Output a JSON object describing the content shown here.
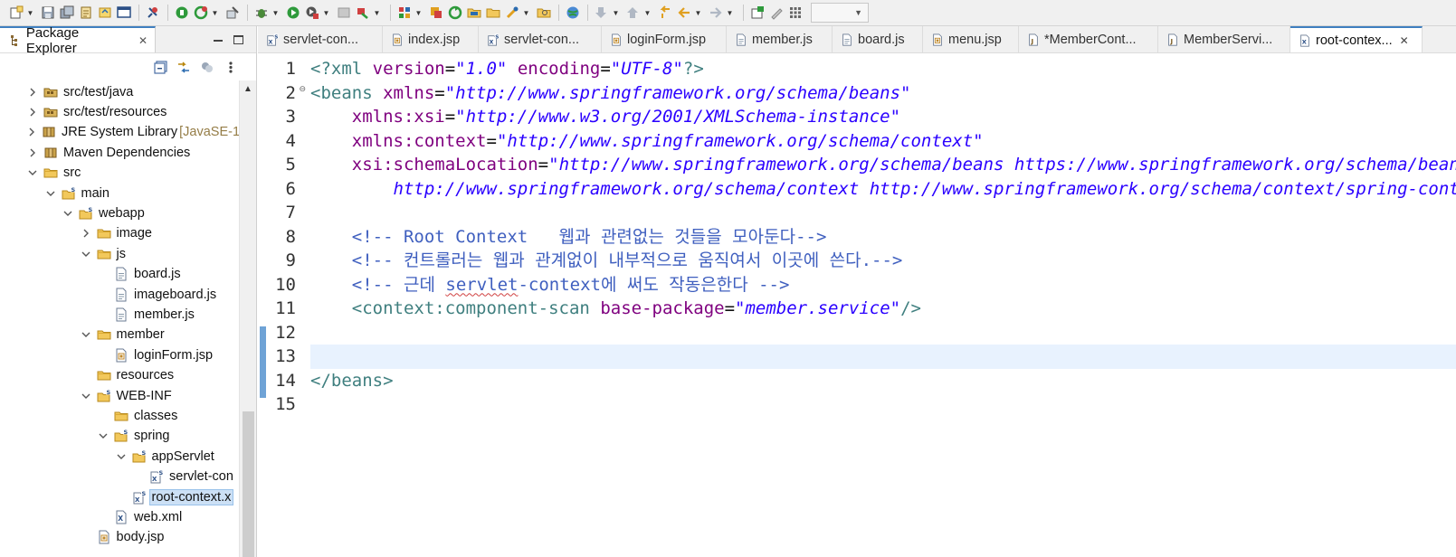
{
  "toolbar": {
    "icons": [
      "new-icon",
      "save-icon",
      "save-all-icon",
      "publish-icon",
      "refactor-icon",
      "console-icon",
      "pin-icon",
      "stop-icon",
      "refresh-icon",
      "deploy-icon",
      "debug-icon",
      "run-icon",
      "run-config-icon",
      "coverage-icon",
      "external-tools-icon",
      "team-icon",
      "compare-icon",
      "synchronize-icon",
      "open-folder-icon",
      "open-type-icon",
      "open-task-icon",
      "search-icon",
      "globe-icon",
      "next-annotation-icon",
      "prev-annotation-icon",
      "last-edit-icon",
      "back-icon",
      "forward-icon",
      "new-window-icon",
      "pen-icon",
      "perspective-icon"
    ],
    "combo_value": ""
  },
  "left_pane": {
    "tab_label": "Package Explorer",
    "tab_close": "✕",
    "view_toolbar_icons": [
      "collapse-all-icon",
      "link-editor-icon",
      "filters-icon",
      "view-menu-icon"
    ],
    "tree": [
      {
        "label": "src/test/java",
        "deco": "",
        "icon": "source-folder-icon",
        "level": 1,
        "state": "collapsed"
      },
      {
        "label": "src/test/resources",
        "deco": "",
        "icon": "source-folder-icon",
        "level": 1,
        "state": "collapsed"
      },
      {
        "label": "JRE System Library",
        "deco": " [JavaSE-1",
        "icon": "library-icon",
        "level": 1,
        "state": "collapsed"
      },
      {
        "label": "Maven Dependencies",
        "deco": "",
        "icon": "library-icon",
        "level": 1,
        "state": "collapsed"
      },
      {
        "label": "src",
        "deco": "",
        "icon": "folder-icon",
        "level": 1,
        "state": "expanded"
      },
      {
        "label": "main",
        "deco": "",
        "icon": "web-folder-icon",
        "level": 2,
        "state": "expanded"
      },
      {
        "label": "webapp",
        "deco": "",
        "icon": "web-folder-icon",
        "level": 3,
        "state": "expanded"
      },
      {
        "label": "image",
        "deco": "",
        "icon": "folder-icon",
        "level": 4,
        "state": "collapsed"
      },
      {
        "label": "js",
        "deco": "",
        "icon": "folder-icon",
        "level": 4,
        "state": "expanded"
      },
      {
        "label": "board.js",
        "deco": "",
        "icon": "js-file-icon",
        "level": 5,
        "state": "leaf"
      },
      {
        "label": "imageboard.js",
        "deco": "",
        "icon": "js-file-icon",
        "level": 5,
        "state": "leaf"
      },
      {
        "label": "member.js",
        "deco": "",
        "icon": "js-file-icon",
        "level": 5,
        "state": "leaf"
      },
      {
        "label": "member",
        "deco": "",
        "icon": "folder-icon",
        "level": 4,
        "state": "expanded"
      },
      {
        "label": "loginForm.jsp",
        "deco": "",
        "icon": "jsp-file-icon",
        "level": 5,
        "state": "leaf"
      },
      {
        "label": "resources",
        "deco": "",
        "icon": "folder-icon",
        "level": 4,
        "state": "leaf"
      },
      {
        "label": "WEB-INF",
        "deco": "",
        "icon": "web-folder-icon",
        "level": 4,
        "state": "expanded"
      },
      {
        "label": "classes",
        "deco": "",
        "icon": "folder-icon",
        "level": 5,
        "state": "leaf"
      },
      {
        "label": "spring",
        "deco": "",
        "icon": "web-folder-icon",
        "level": 5,
        "state": "expanded"
      },
      {
        "label": "appServlet",
        "deco": "",
        "icon": "web-folder-icon",
        "level": 6,
        "state": "expanded"
      },
      {
        "label": "servlet-con",
        "deco": "",
        "icon": "spring-xml-icon",
        "level": 7,
        "state": "leaf"
      },
      {
        "label": "root-context.x",
        "deco": "",
        "icon": "spring-xml-icon",
        "level": 6,
        "state": "leaf",
        "selected": true
      },
      {
        "label": "web.xml",
        "deco": "",
        "icon": "xml-file-icon",
        "level": 5,
        "state": "leaf"
      },
      {
        "label": "body.jsp",
        "deco": "",
        "icon": "jsp-file-icon",
        "level": 4,
        "state": "leaf"
      }
    ]
  },
  "editor": {
    "tabs": [
      {
        "label": "servlet-con...",
        "icon": "spring-xml-icon",
        "active": false
      },
      {
        "label": "index.jsp",
        "icon": "jsp-file-icon",
        "active": false
      },
      {
        "label": "servlet-con...",
        "icon": "spring-xml-icon",
        "active": false
      },
      {
        "label": "loginForm.jsp",
        "icon": "jsp-file-icon",
        "active": false
      },
      {
        "label": "member.js",
        "icon": "js-file-icon",
        "active": false
      },
      {
        "label": "board.js",
        "icon": "js-file-icon",
        "active": false
      },
      {
        "label": "menu.jsp",
        "icon": "jsp-file-icon",
        "active": false
      },
      {
        "label": "*MemberCont...",
        "icon": "java-file-icon",
        "active": false
      },
      {
        "label": "MemberServi...",
        "icon": "java-file-icon",
        "active": false
      },
      {
        "label": "root-contex...",
        "icon": "xml-file-icon",
        "active": true,
        "close": "✕"
      }
    ],
    "current_line": 13,
    "lines": [
      {
        "n": "1",
        "fold": "",
        "tokens": [
          [
            "tag",
            "<?xml "
          ],
          [
            "attr",
            "version"
          ],
          [
            "plain",
            "="
          ],
          [
            "val",
            "\"1.0\""
          ],
          [
            "plain",
            " "
          ],
          [
            "attr",
            "encoding"
          ],
          [
            "plain",
            "="
          ],
          [
            "val",
            "\"UTF-8\""
          ],
          [
            "tag",
            "?>"
          ]
        ]
      },
      {
        "n": "2",
        "fold": "⊖",
        "tokens": [
          [
            "tag",
            "<beans "
          ],
          [
            "attr",
            "xmlns"
          ],
          [
            "plain",
            "="
          ],
          [
            "val",
            "\"http://www.springframework.org/schema/beans\""
          ]
        ]
      },
      {
        "n": "3",
        "fold": "",
        "tokens": [
          [
            "plain",
            "    "
          ],
          [
            "attr",
            "xmlns:xsi"
          ],
          [
            "plain",
            "="
          ],
          [
            "val",
            "\"http://www.w3.org/2001/XMLSchema-instance\""
          ]
        ]
      },
      {
        "n": "4",
        "fold": "",
        "tokens": [
          [
            "plain",
            "    "
          ],
          [
            "attr",
            "xmlns:context"
          ],
          [
            "plain",
            "="
          ],
          [
            "val",
            "\"http://www.springframework.org/schema/context\""
          ]
        ]
      },
      {
        "n": "5",
        "fold": "",
        "tokens": [
          [
            "plain",
            "    "
          ],
          [
            "attr",
            "xsi:schemaLocation"
          ],
          [
            "plain",
            "="
          ],
          [
            "val",
            "\"http://www.springframework.org/schema/beans https://www.springframework.org/schema/beans/spring-beans.xsd"
          ]
        ]
      },
      {
        "n": "6",
        "fold": "",
        "tokens": [
          [
            "val",
            "        http://www.springframework.org/schema/context http://www.springframework.org/schema/context/spring-context.xsd\""
          ],
          [
            "tag",
            ">"
          ]
        ]
      },
      {
        "n": "7",
        "fold": "",
        "tokens": []
      },
      {
        "n": "8",
        "fold": "",
        "tokens": [
          [
            "plain",
            "    "
          ],
          [
            "cmt",
            "<!-- Root Context   웹과 관련없는 것들을 모아둔다-->"
          ]
        ]
      },
      {
        "n": "9",
        "fold": "",
        "tokens": [
          [
            "plain",
            "    "
          ],
          [
            "cmt",
            "<!-- 컨트롤러는 웹과 관계없이 내부적으로 움직여서 이곳에 쓴다.-->"
          ]
        ]
      },
      {
        "n": "10",
        "fold": "",
        "tokens": [
          [
            "plain",
            "    "
          ],
          [
            "cmt",
            "<!-- 근데 "
          ],
          [
            "cmtsq",
            "servlet"
          ],
          [
            "cmt",
            "-context에 써도 작동은한다 -->"
          ]
        ]
      },
      {
        "n": "11",
        "fold": "",
        "tokens": [
          [
            "plain",
            "    "
          ],
          [
            "tag",
            "<context:component-scan "
          ],
          [
            "attr",
            "base-package"
          ],
          [
            "plain",
            "="
          ],
          [
            "val",
            "\"member.service\""
          ],
          [
            "tag",
            "/>"
          ]
        ]
      },
      {
        "n": "12",
        "fold": "",
        "tokens": []
      },
      {
        "n": "13",
        "fold": "",
        "tokens": []
      },
      {
        "n": "14",
        "fold": "",
        "tokens": [
          [
            "tag",
            "</beans>"
          ]
        ]
      },
      {
        "n": "15",
        "fold": "",
        "tokens": []
      }
    ]
  },
  "colors": {
    "tag": "#3f7f7f",
    "attr": "#7f007f",
    "value": "#2a00ff",
    "comment": "#3f5fbf",
    "current_line": "#e8f2fe",
    "active_tab_accent": "#3f7fbf",
    "selection": "#cce0f5"
  }
}
